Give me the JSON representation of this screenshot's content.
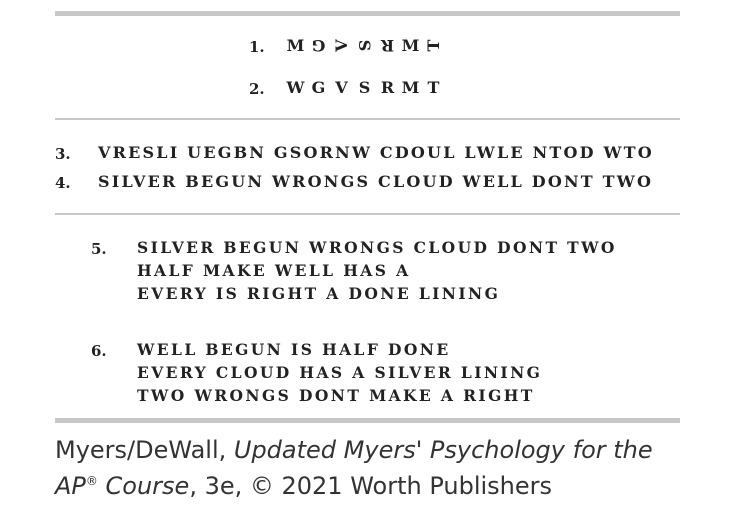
{
  "items": {
    "item1": {
      "number": "1.",
      "letters": [
        "M",
        "G",
        "V",
        "S",
        "R",
        "M",
        "T"
      ]
    },
    "item2": {
      "number": "2.",
      "letters": [
        "W",
        "G",
        "V",
        "S",
        "R",
        "M",
        "T"
      ]
    },
    "item3": {
      "number": "3.",
      "text": "VRESLI UEGBN GSORNW CDOUL LWLE NTOD WTO"
    },
    "item4": {
      "number": "4.",
      "text": "SILVER BEGUN WRONGS CLOUD WELL DONT TWO"
    },
    "item5": {
      "number": "5.",
      "lines": [
        "SILVER BEGUN WRONGS CLOUD DONT TWO",
        "HALF MAKE WELL HAS A",
        "EVERY IS RIGHT A DONE LINING"
      ]
    },
    "item6": {
      "number": "6.",
      "lines": [
        "WELL BEGUN IS HALF DONE",
        "EVERY CLOUD HAS A SILVER LINING",
        "TWO WRONGS DONT MAKE A RIGHT"
      ]
    }
  },
  "caption": {
    "authors": "Myers/DeWall, ",
    "book_title_part1": "Updated Myers' Psychology for the",
    "book_title_part2": "AP",
    "registered_mark": "®",
    "book_title_part3": " Course",
    "edition_and_publisher": ", 3e, © 2021 Worth Publishers"
  },
  "colors": {
    "rule": "#c8c8c8",
    "text": "#222222",
    "caption": "#333333"
  }
}
